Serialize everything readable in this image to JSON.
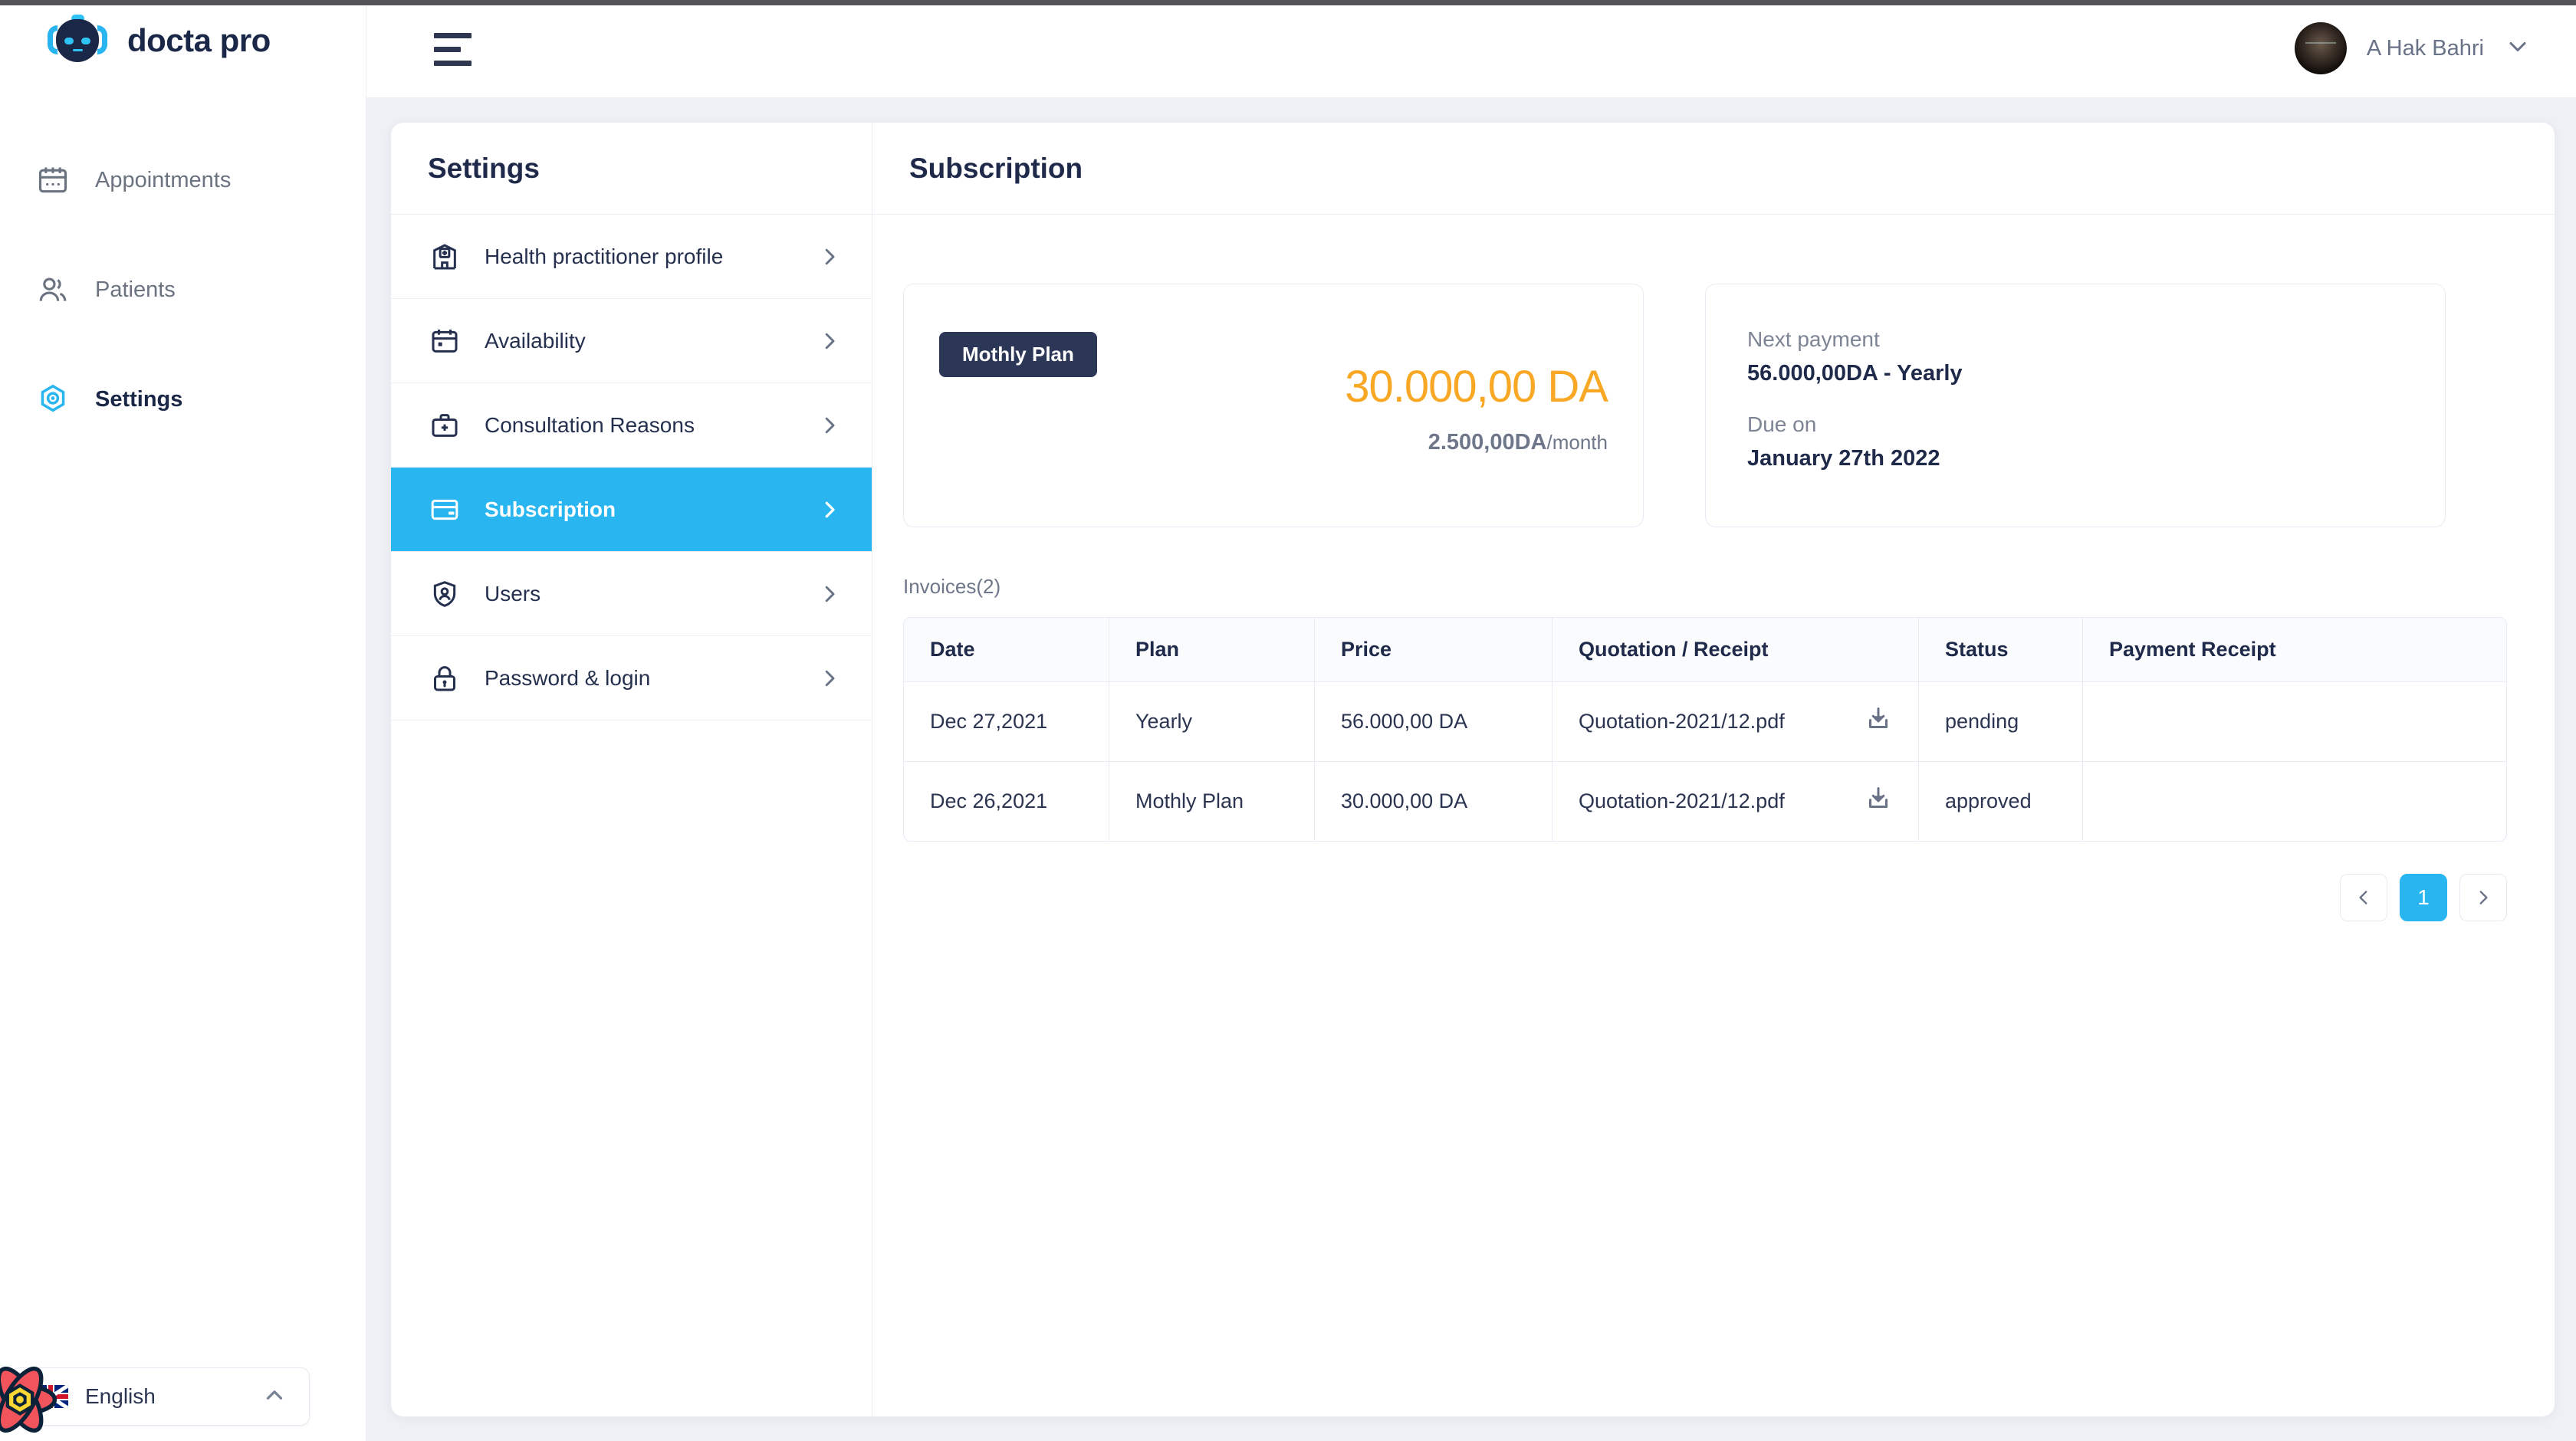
{
  "brand": {
    "name": "docta pro"
  },
  "sidebar": {
    "items": [
      {
        "label": "Appointments",
        "icon": "calendar-icon",
        "active": false
      },
      {
        "label": "Patients",
        "icon": "users-icon",
        "active": false
      },
      {
        "label": "Settings",
        "icon": "settings-hex-icon",
        "active": true
      }
    ],
    "language": {
      "label": "English",
      "flag": "uk-flag-icon",
      "chevron": "chevron-up-icon"
    }
  },
  "topbar": {
    "menu_icon": "hamburger-icon",
    "user_name": "A Hak Bahri",
    "user_chevron": "chevron-down-icon"
  },
  "settings": {
    "title": "Settings",
    "items": [
      {
        "label": "Health practitioner profile",
        "icon": "hospital-icon"
      },
      {
        "label": "Availability",
        "icon": "calendar-icon"
      },
      {
        "label": "Consultation Reasons",
        "icon": "medical-bag-icon"
      },
      {
        "label": "Subscription",
        "icon": "card-icon"
      },
      {
        "label": "Users",
        "icon": "shield-user-icon"
      },
      {
        "label": "Password & login",
        "icon": "lock-icon"
      }
    ],
    "active_index": 3
  },
  "subscription": {
    "title": "Subscription",
    "plan_card": {
      "badge": "Mothly Plan",
      "price": "30.000,00 DA",
      "sub_price": "2.500,00DA",
      "sub_unit": "/month"
    },
    "payment_card": {
      "next_payment_label": "Next payment",
      "next_payment_value": "56.000,00DA - Yearly",
      "due_on_label": "Due on",
      "due_on_value": "January 27th 2022"
    },
    "invoices_label": "Invoices(2)",
    "table": {
      "columns": [
        "Date",
        "Plan",
        "Price",
        "Quotation / Receipt",
        "Status",
        "Payment Receipt"
      ],
      "rows": [
        {
          "date": "Dec 27,2021",
          "plan": "Yearly",
          "price": "56.000,00 DA",
          "document": "Quotation-2021/12.pdf",
          "download_icon": "download-icon",
          "status": "pending",
          "status_color": "#f9a825",
          "payment_receipt": ""
        },
        {
          "date": "Dec 26,2021",
          "plan": "Mothly Plan",
          "price": "30.000,00 DA",
          "document": "Quotation-2021/12.pdf",
          "download_icon": "download-icon",
          "status": "approved",
          "status_color": "#2fd48a",
          "payment_receipt": ""
        }
      ]
    },
    "pagination": {
      "prev": "‹",
      "pages": [
        "1"
      ],
      "next": "›",
      "current": "1"
    }
  },
  "colors": {
    "accent_blue": "#29b6f0",
    "navy": "#1f2a4a",
    "amber": "#f9a825",
    "green": "#2fd48a",
    "page_bg": "#eef0f5"
  }
}
